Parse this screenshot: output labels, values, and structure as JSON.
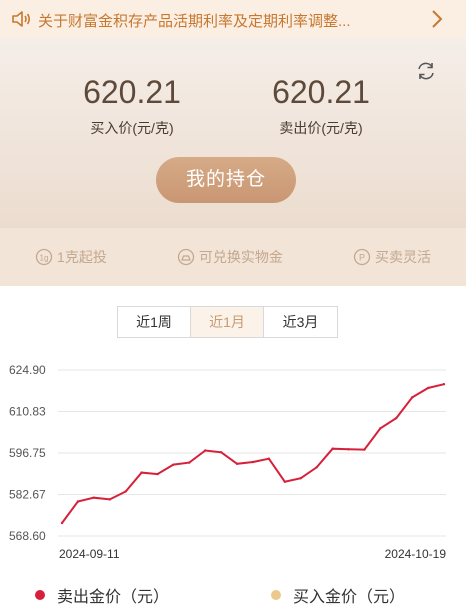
{
  "notice": {
    "text": "关于财富金积存产品活期利率及定期利率调整...",
    "icon": "speaker-icon",
    "arrow_icon": "chevron-right-icon"
  },
  "prices": {
    "buy_price": "620.21",
    "buy_label": "买入价(元/克)",
    "sell_price": "620.21",
    "sell_label": "卖出价(元/克)",
    "refresh_icon": "refresh-icon"
  },
  "hold_button": "我的持仓",
  "features": [
    {
      "label": "1克起投",
      "icon": "gram-icon"
    },
    {
      "label": "可兑换实物金",
      "icon": "gold-bar-icon"
    },
    {
      "label": "买卖灵活",
      "icon": "p-coin-icon"
    }
  ],
  "tabs": [
    {
      "label": "近1周",
      "active": false
    },
    {
      "label": "近1月",
      "active": true
    },
    {
      "label": "近3月",
      "active": false
    }
  ],
  "colors": {
    "accent": "#c89a70",
    "sell_line": "#d6213a",
    "buy_dot": "#ecc88f",
    "notice_text": "#c7772f"
  },
  "chart_data": {
    "type": "line",
    "y_ticks": [
      "624.90",
      "610.83",
      "596.75",
      "582.67",
      "568.60"
    ],
    "ylim": [
      568.6,
      624.9
    ],
    "x_tick_labels": [
      "2024-09-11",
      "2024-10-19"
    ],
    "grid": true,
    "legend_position": "bottom",
    "series": [
      {
        "name": "卖出金价（元）",
        "color": "#d6213a",
        "values": [
          573.0,
          580.3,
          581.6,
          581.0,
          583.7,
          590.1,
          589.6,
          592.8,
          593.5,
          597.6,
          597.0,
          593.1,
          593.7,
          594.8,
          587.0,
          588.2,
          591.9,
          598.2,
          598.0,
          597.9,
          605.1,
          608.6,
          615.6,
          618.8,
          620.1
        ]
      }
    ],
    "legend": [
      {
        "label": "卖出金价（元）",
        "color": "#d6213a"
      },
      {
        "label": "买入金价（元）",
        "color": "#ecc88f"
      }
    ]
  }
}
